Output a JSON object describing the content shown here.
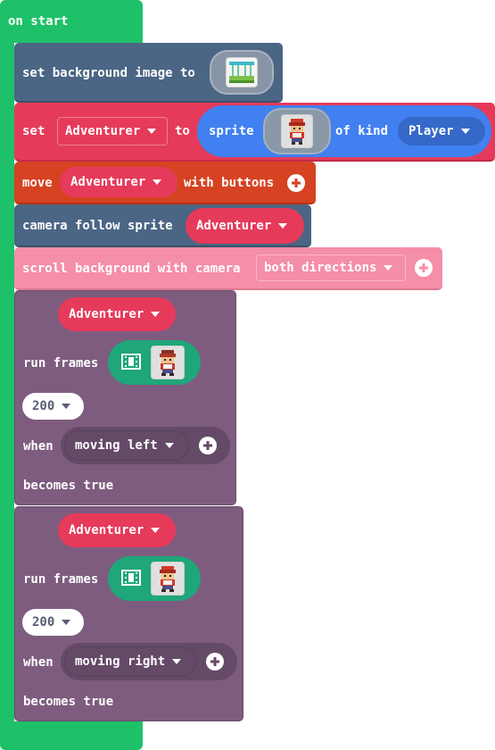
{
  "hat": {
    "label": "on start"
  },
  "set_bg": {
    "label": "set background image to",
    "image_icon": "landscape-thumbnail-icon"
  },
  "set_sprite": {
    "set_label": "set",
    "variable": "Adventurer",
    "to_label": "to",
    "sprite_label": "sprite",
    "sprite_icon": "adventurer-sprite-icon",
    "of_kind_label": "of kind",
    "kind": "Player"
  },
  "move": {
    "label": "move",
    "variable": "Adventurer",
    "with_label": "with buttons"
  },
  "camera": {
    "label": "camera follow sprite",
    "variable": "Adventurer"
  },
  "scroll": {
    "label": "scroll background with camera",
    "direction": "both directions"
  },
  "anim1": {
    "variable": "Adventurer",
    "run_frames_label": "run frames",
    "interval": "200",
    "when_label": "when",
    "condition": "moving left",
    "becomes_label": "becomes true"
  },
  "anim2": {
    "variable": "Adventurer",
    "run_frames_label": "run frames",
    "interval": "200",
    "when_label": "when",
    "condition": "moving right",
    "becomes_label": "becomes true"
  },
  "colors": {
    "hat_green": "#1ec169",
    "scene_blue": "#4b6584",
    "sprite_red": "#e63a5a",
    "controller_orange": "#d54322",
    "scroll_pink": "#f58ea8",
    "animation_purple": "#7e5c80",
    "sprite_pill_blue": "#4080f0",
    "frames_teal": "#1fa67a"
  }
}
